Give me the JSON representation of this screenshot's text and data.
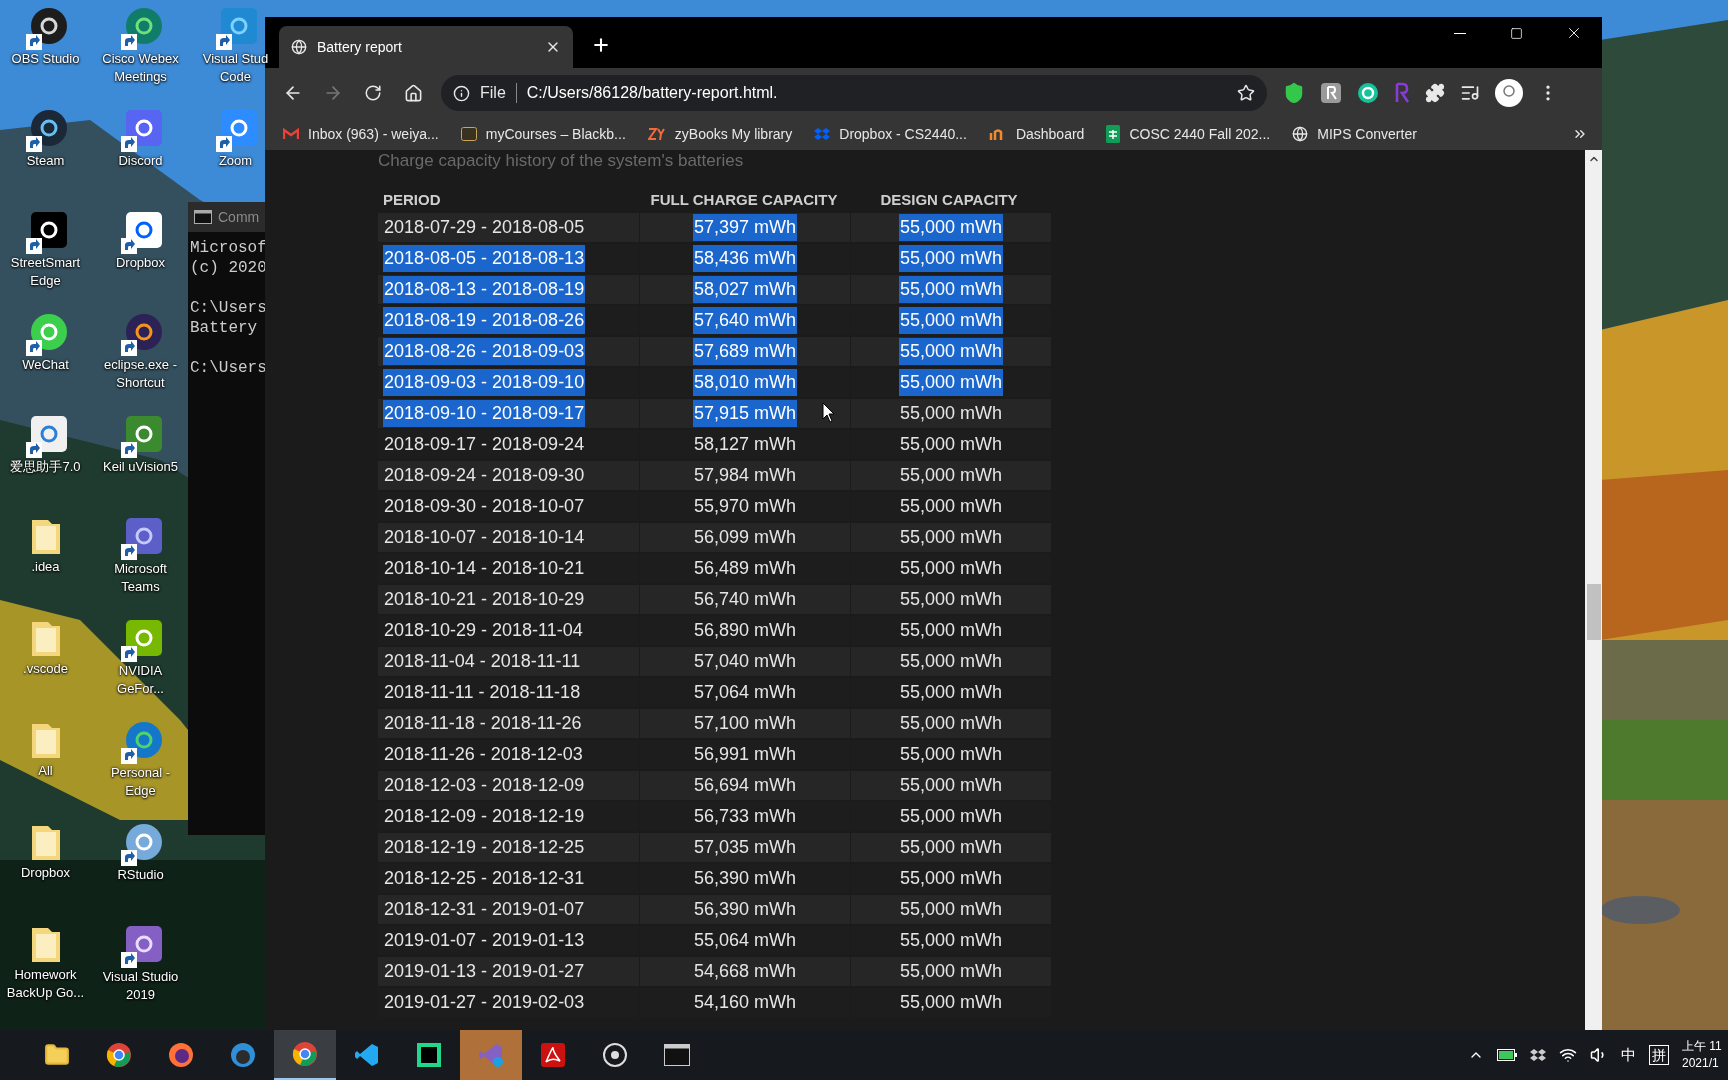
{
  "desktop_icons": [
    {
      "label_lines": [
        "OBS Studio"
      ]
    },
    {
      "label_lines": [
        "Steam"
      ]
    },
    {
      "label_lines": [
        "StreetSmart",
        "Edge"
      ]
    },
    {
      "label_lines": [
        "WeChat"
      ]
    },
    {
      "label_lines": [
        "爱思助手7.0"
      ]
    },
    {
      "label_lines": [
        ".idea"
      ]
    },
    {
      "label_lines": [
        ".vscode"
      ]
    },
    {
      "label_lines": [
        "All"
      ]
    },
    {
      "label_lines": [
        "Dropbox"
      ]
    },
    {
      "label_lines": [
        "Homework",
        "BackUp Go..."
      ]
    },
    {
      "label_lines": [
        "Cisco Webex",
        "Meetings"
      ]
    },
    {
      "label_lines": [
        "Discord"
      ]
    },
    {
      "label_lines": [
        "Dropbox"
      ]
    },
    {
      "label_lines": [
        "eclipse.exe -",
        "Shortcut"
      ]
    },
    {
      "label_lines": [
        "Keil uVision5"
      ]
    },
    {
      "label_lines": [
        "Microsoft",
        "Teams"
      ]
    },
    {
      "label_lines": [
        "NVIDIA",
        "GeFor..."
      ]
    },
    {
      "label_lines": [
        "Personal -",
        "Edge"
      ]
    },
    {
      "label_lines": [
        "RStudio"
      ]
    },
    {
      "label_lines": [
        "Visual Studio",
        "2019"
      ]
    },
    {
      "label_lines": [
        "Visual Stud",
        "Code"
      ]
    },
    {
      "label_lines": [
        "Zoom"
      ]
    }
  ],
  "terminal": {
    "title": "Comm",
    "blocks": [
      [
        "Microsof",
        "(c) 2020"
      ],
      [
        "C:\\Users",
        "Battery"
      ],
      [
        "C:\\Users"
      ]
    ]
  },
  "browser": {
    "tab": {
      "title": "Battery report"
    },
    "nav": {
      "forward_disabled": true
    },
    "address": {
      "scheme": "File",
      "url": "C:/Users/86128/battery-report.html."
    },
    "bookmarks": [
      {
        "label": "Inbox (963) - weiya..."
      },
      {
        "label": "myCourses – Blackb..."
      },
      {
        "label": "zyBooks My library"
      },
      {
        "label": "Dropbox - CS2440..."
      },
      {
        "label": "Dashboard"
      },
      {
        "label": "COSC 2440 Fall 202..."
      },
      {
        "label": "MIPS Converter"
      }
    ]
  },
  "report": {
    "subtitle": "Charge capacity history of the system's batteries",
    "columns": [
      "PERIOD",
      "FULL CHARGE CAPACITY",
      "DESIGN CAPACITY"
    ],
    "rows": [
      {
        "cells": [
          {
            "text": "2018-07-29 - 2018-08-05",
            "selected": false
          },
          {
            "text": "57,397 mWh",
            "selected": true
          },
          {
            "text": "55,000 mWh",
            "selected": true
          }
        ]
      },
      {
        "cells": [
          {
            "text": "2018-08-05 - 2018-08-13",
            "selected": true
          },
          {
            "text": "58,436 mWh",
            "selected": true
          },
          {
            "text": "55,000 mWh",
            "selected": true
          }
        ]
      },
      {
        "cells": [
          {
            "text": "2018-08-13 - 2018-08-19",
            "selected": true
          },
          {
            "text": "58,027 mWh",
            "selected": true
          },
          {
            "text": "55,000 mWh",
            "selected": true
          }
        ]
      },
      {
        "cells": [
          {
            "text": "2018-08-19 - 2018-08-26",
            "selected": true
          },
          {
            "text": "57,640 mWh",
            "selected": true
          },
          {
            "text": "55,000 mWh",
            "selected": true
          }
        ]
      },
      {
        "cells": [
          {
            "text": "2018-08-26 - 2018-09-03",
            "selected": true
          },
          {
            "text": "57,689 mWh",
            "selected": true
          },
          {
            "text": "55,000 mWh",
            "selected": true
          }
        ]
      },
      {
        "cells": [
          {
            "text": "2018-09-03 - 2018-09-10",
            "selected": true
          },
          {
            "text": "58,010 mWh",
            "selected": true
          },
          {
            "text": "55,000 mWh",
            "selected": true
          }
        ]
      },
      {
        "cells": [
          {
            "text": "2018-09-10 - 2018-09-17",
            "selected": true
          },
          {
            "text": "57,915 mWh",
            "selected": true
          },
          {
            "text": "55,000 mWh",
            "selected": false
          }
        ]
      },
      {
        "cells": [
          {
            "text": "2018-09-17 - 2018-09-24",
            "selected": false
          },
          {
            "text": "58,127 mWh",
            "selected": false
          },
          {
            "text": "55,000 mWh",
            "selected": false
          }
        ]
      },
      {
        "cells": [
          {
            "text": "2018-09-24 - 2018-09-30",
            "selected": false
          },
          {
            "text": "57,984 mWh",
            "selected": false
          },
          {
            "text": "55,000 mWh",
            "selected": false
          }
        ]
      },
      {
        "cells": [
          {
            "text": "2018-09-30 - 2018-10-07",
            "selected": false
          },
          {
            "text": "55,970 mWh",
            "selected": false
          },
          {
            "text": "55,000 mWh",
            "selected": false
          }
        ]
      },
      {
        "cells": [
          {
            "text": "2018-10-07 - 2018-10-14",
            "selected": false
          },
          {
            "text": "56,099 mWh",
            "selected": false
          },
          {
            "text": "55,000 mWh",
            "selected": false
          }
        ]
      },
      {
        "cells": [
          {
            "text": "2018-10-14 - 2018-10-21",
            "selected": false
          },
          {
            "text": "56,489 mWh",
            "selected": false
          },
          {
            "text": "55,000 mWh",
            "selected": false
          }
        ]
      },
      {
        "cells": [
          {
            "text": "2018-10-21 - 2018-10-29",
            "selected": false
          },
          {
            "text": "56,740 mWh",
            "selected": false
          },
          {
            "text": "55,000 mWh",
            "selected": false
          }
        ]
      },
      {
        "cells": [
          {
            "text": "2018-10-29 - 2018-11-04",
            "selected": false
          },
          {
            "text": "56,890 mWh",
            "selected": false
          },
          {
            "text": "55,000 mWh",
            "selected": false
          }
        ]
      },
      {
        "cells": [
          {
            "text": "2018-11-04 - 2018-11-11",
            "selected": false
          },
          {
            "text": "57,040 mWh",
            "selected": false
          },
          {
            "text": "55,000 mWh",
            "selected": false
          }
        ]
      },
      {
        "cells": [
          {
            "text": "2018-11-11 - 2018-11-18",
            "selected": false
          },
          {
            "text": "57,064 mWh",
            "selected": false
          },
          {
            "text": "55,000 mWh",
            "selected": false
          }
        ]
      },
      {
        "cells": [
          {
            "text": "2018-11-18 - 2018-11-26",
            "selected": false
          },
          {
            "text": "57,100 mWh",
            "selected": false
          },
          {
            "text": "55,000 mWh",
            "selected": false
          }
        ]
      },
      {
        "cells": [
          {
            "text": "2018-11-26 - 2018-12-03",
            "selected": false
          },
          {
            "text": "56,991 mWh",
            "selected": false
          },
          {
            "text": "55,000 mWh",
            "selected": false
          }
        ]
      },
      {
        "cells": [
          {
            "text": "2018-12-03 - 2018-12-09",
            "selected": false
          },
          {
            "text": "56,694 mWh",
            "selected": false
          },
          {
            "text": "55,000 mWh",
            "selected": false
          }
        ]
      },
      {
        "cells": [
          {
            "text": "2018-12-09 - 2018-12-19",
            "selected": false
          },
          {
            "text": "56,733 mWh",
            "selected": false
          },
          {
            "text": "55,000 mWh",
            "selected": false
          }
        ]
      },
      {
        "cells": [
          {
            "text": "2018-12-19 - 2018-12-25",
            "selected": false
          },
          {
            "text": "57,035 mWh",
            "selected": false
          },
          {
            "text": "55,000 mWh",
            "selected": false
          }
        ]
      },
      {
        "cells": [
          {
            "text": "2018-12-25 - 2018-12-31",
            "selected": false
          },
          {
            "text": "56,390 mWh",
            "selected": false
          },
          {
            "text": "55,000 mWh",
            "selected": false
          }
        ]
      },
      {
        "cells": [
          {
            "text": "2018-12-31 - 2019-01-07",
            "selected": false
          },
          {
            "text": "56,390 mWh",
            "selected": false
          },
          {
            "text": "55,000 mWh",
            "selected": false
          }
        ]
      },
      {
        "cells": [
          {
            "text": "2019-01-07 - 2019-01-13",
            "selected": false
          },
          {
            "text": "55,064 mWh",
            "selected": false
          },
          {
            "text": "55,000 mWh",
            "selected": false
          }
        ]
      },
      {
        "cells": [
          {
            "text": "2019-01-13 - 2019-01-27",
            "selected": false
          },
          {
            "text": "54,668 mWh",
            "selected": false
          },
          {
            "text": "55,000 mWh",
            "selected": false
          }
        ]
      },
      {
        "cells": [
          {
            "text": "2019-01-27 - 2019-02-03",
            "selected": false
          },
          {
            "text": "54,160 mWh",
            "selected": false
          },
          {
            "text": "55,000 mWh",
            "selected": false
          }
        ]
      }
    ]
  },
  "taskbar": {
    "items": [
      {
        "active": false,
        "attention": false
      },
      {
        "active": false,
        "attention": false
      },
      {
        "active": false,
        "attention": false
      },
      {
        "active": false,
        "attention": false
      },
      {
        "active": true,
        "attention": false
      },
      {
        "active": false,
        "attention": false
      },
      {
        "active": false,
        "attention": false
      },
      {
        "active": false,
        "attention": true
      },
      {
        "active": false,
        "attention": false
      },
      {
        "active": false,
        "attention": false
      },
      {
        "active": false,
        "attention": false
      }
    ],
    "tray": {
      "input_mode": "中",
      "ime": "拼",
      "clock": [
        "上午 11",
        "2021/1"
      ]
    }
  }
}
